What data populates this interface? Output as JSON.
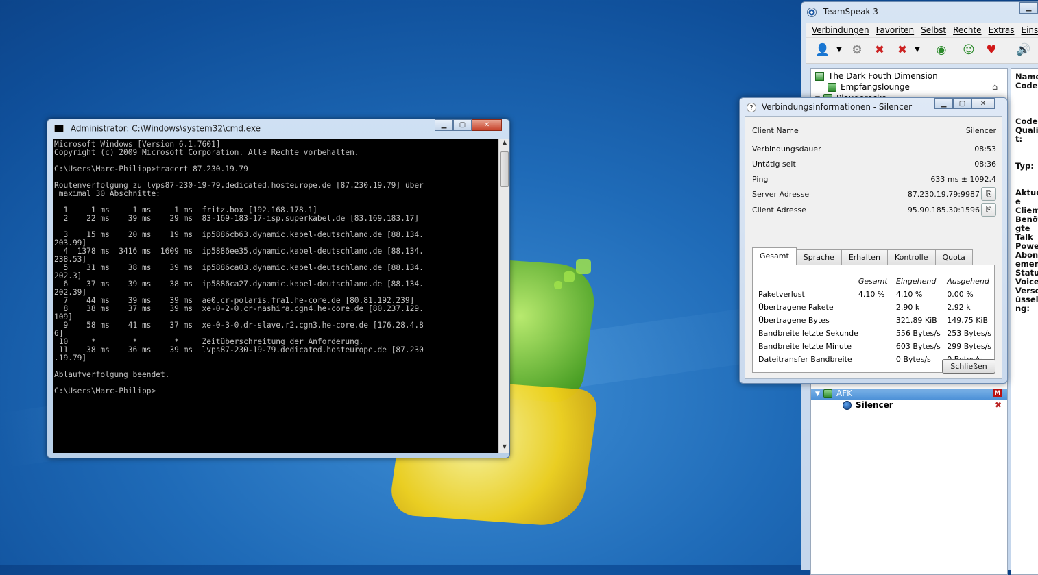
{
  "cmd": {
    "title": "Administrator: C:\\Windows\\system32\\cmd.exe",
    "output": "Microsoft Windows [Version 6.1.7601]\nCopyright (c) 2009 Microsoft Corporation. Alle Rechte vorbehalten.\n\nC:\\Users\\Marc-Philipp>tracert 87.230.19.79\n\nRoutenverfolgung zu lvps87-230-19-79.dedicated.hosteurope.de [87.230.19.79] über\n maximal 30 Abschnitte:\n\n  1     1 ms     1 ms     1 ms  fritz.box [192.168.178.1]\n  2    22 ms    39 ms    29 ms  83-169-183-17-isp.superkabel.de [83.169.183.17]\n\n  3    15 ms    20 ms    19 ms  ip5886cb63.dynamic.kabel-deutschland.de [88.134.\n203.99]\n  4  1378 ms  3416 ms  1609 ms  ip5886ee35.dynamic.kabel-deutschland.de [88.134.\n238.53]\n  5    31 ms    38 ms    39 ms  ip5886ca03.dynamic.kabel-deutschland.de [88.134.\n202.3]\n  6    37 ms    39 ms    38 ms  ip5886ca27.dynamic.kabel-deutschland.de [88.134.\n202.39]\n  7    44 ms    39 ms    39 ms  ae0.cr-polaris.fra1.he-core.de [80.81.192.239]\n  8    38 ms    37 ms    39 ms  xe-0-2-0.cr-nashira.cgn4.he-core.de [80.237.129.\n109]\n  9    58 ms    41 ms    37 ms  xe-0-3-0.dr-slave.r2.cgn3.he-core.de [176.28.4.8\n6]\n 10     *        *        *     Zeitüberschreitung der Anforderung.\n 11    38 ms    36 ms    39 ms  lvps87-230-19-79.dedicated.hosteurope.de [87.230\n.19.79]\n\nAblaufverfolgung beendet.\n\nC:\\Users\\Marc-Philipp>_"
  },
  "teamspeak": {
    "title": "TeamSpeak 3",
    "menu": [
      "Verbindungen",
      "Favoriten",
      "Selbst",
      "Rechte",
      "Extras",
      "Einstellu"
    ],
    "tree": {
      "server": "The Dark Fouth Dimension",
      "channels": [
        "Empfangslounge",
        "Plauderecke"
      ],
      "afk_channel": "AFK",
      "user": "Silencer"
    },
    "side_info": "Name\nCodec\n\n\n\nCodec\nQualit\nt:\n\n\nTyp:\n\n\nAktue\ne\nClients\nBenöt\ngte\nTalk\nPower\nAbonn\nement\nStatus\nVoice\nVersc\nüsselu\nng:"
  },
  "dialog": {
    "title": "Verbindungsinformationen - Silencer",
    "info": [
      {
        "label": "Client Name",
        "value": "Silencer"
      },
      {
        "label": "Verbindungsdauer",
        "value": "08:53"
      },
      {
        "label": "Untätig seit",
        "value": "08:36"
      },
      {
        "label": "Ping",
        "value": "633 ms ± 1092.4"
      },
      {
        "label": "Server Adresse",
        "value": "87.230.19.79:9987"
      },
      {
        "label": "Client Adresse",
        "value": "95.90.185.30:1596"
      }
    ],
    "tabs": [
      "Gesamt",
      "Sprache",
      "Erhalten",
      "Kontrolle",
      "Quota"
    ],
    "table": {
      "headers": [
        "",
        "Gesamt",
        "Eingehend",
        "Ausgehend"
      ],
      "rows": [
        [
          "Paketverlust",
          "4.10 %",
          "4.10 %",
          "0.00 %"
        ],
        [
          "Übertragene Pakete",
          "",
          "2.90 k",
          "2.92 k"
        ],
        [
          "Übertragene Bytes",
          "",
          "321.89 KiB",
          "149.75 KiB"
        ],
        [
          "Bandbreite letzte Sekunde",
          "",
          "556 Bytes/s",
          "253 Bytes/s"
        ],
        [
          "Bandbreite letzte Minute",
          "",
          "603 Bytes/s",
          "299 Bytes/s"
        ],
        [
          "Dateitransfer Bandbreite",
          "",
          "0 Bytes/s",
          "0 Bytes/s"
        ]
      ]
    },
    "close_label": "Schließen"
  }
}
